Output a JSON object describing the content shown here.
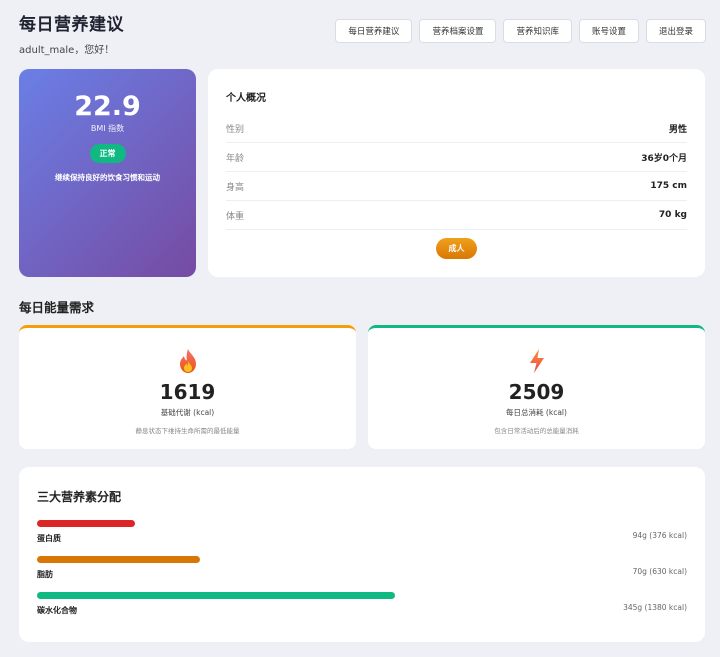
{
  "header": {
    "title": "每日营养建议",
    "greeting": "adult_male，您好！"
  },
  "nav": [
    "每日营养建议",
    "营养档案设置",
    "营养知识库",
    "账号设置",
    "退出登录"
  ],
  "bmi": {
    "value": "22.9",
    "label": "BMI 指数",
    "status": "正常",
    "advice": "继续保持良好的饮食习惯和运动",
    "status_color": "#10b981"
  },
  "profile": {
    "title": "个人概况",
    "rows": [
      {
        "key": "性别",
        "value": "男性"
      },
      {
        "key": "年龄",
        "value": "36岁0个月"
      },
      {
        "key": "身高",
        "value": "175 cm"
      },
      {
        "key": "体重",
        "value": "70 kg"
      }
    ],
    "stage": "成人"
  },
  "energy": {
    "section_title": "每日能量需求",
    "bmr": {
      "icon": "fire-icon",
      "value": "1619",
      "label": "基础代谢 (kcal)",
      "desc": "静息状态下维持生命所需的最低能量",
      "accent": "#f59e0b"
    },
    "tdee": {
      "icon": "lightning-icon",
      "value": "2509",
      "label": "每日总消耗 (kcal)",
      "desc": "包含日常活动后的总能量消耗",
      "accent": "#10b981"
    }
  },
  "macros": {
    "title": "三大营养素分配",
    "items": [
      {
        "name": "蛋白质",
        "amount": "94g (376 kcal)",
        "share": 0.15,
        "color": "#dc2626"
      },
      {
        "name": "脂肪",
        "amount": "70g (630 kcal)",
        "share": 0.25,
        "color": "#d97706"
      },
      {
        "name": "碳水化合物",
        "amount": "345g (1380 kcal)",
        "share": 0.55,
        "color": "#10b981"
      }
    ]
  }
}
